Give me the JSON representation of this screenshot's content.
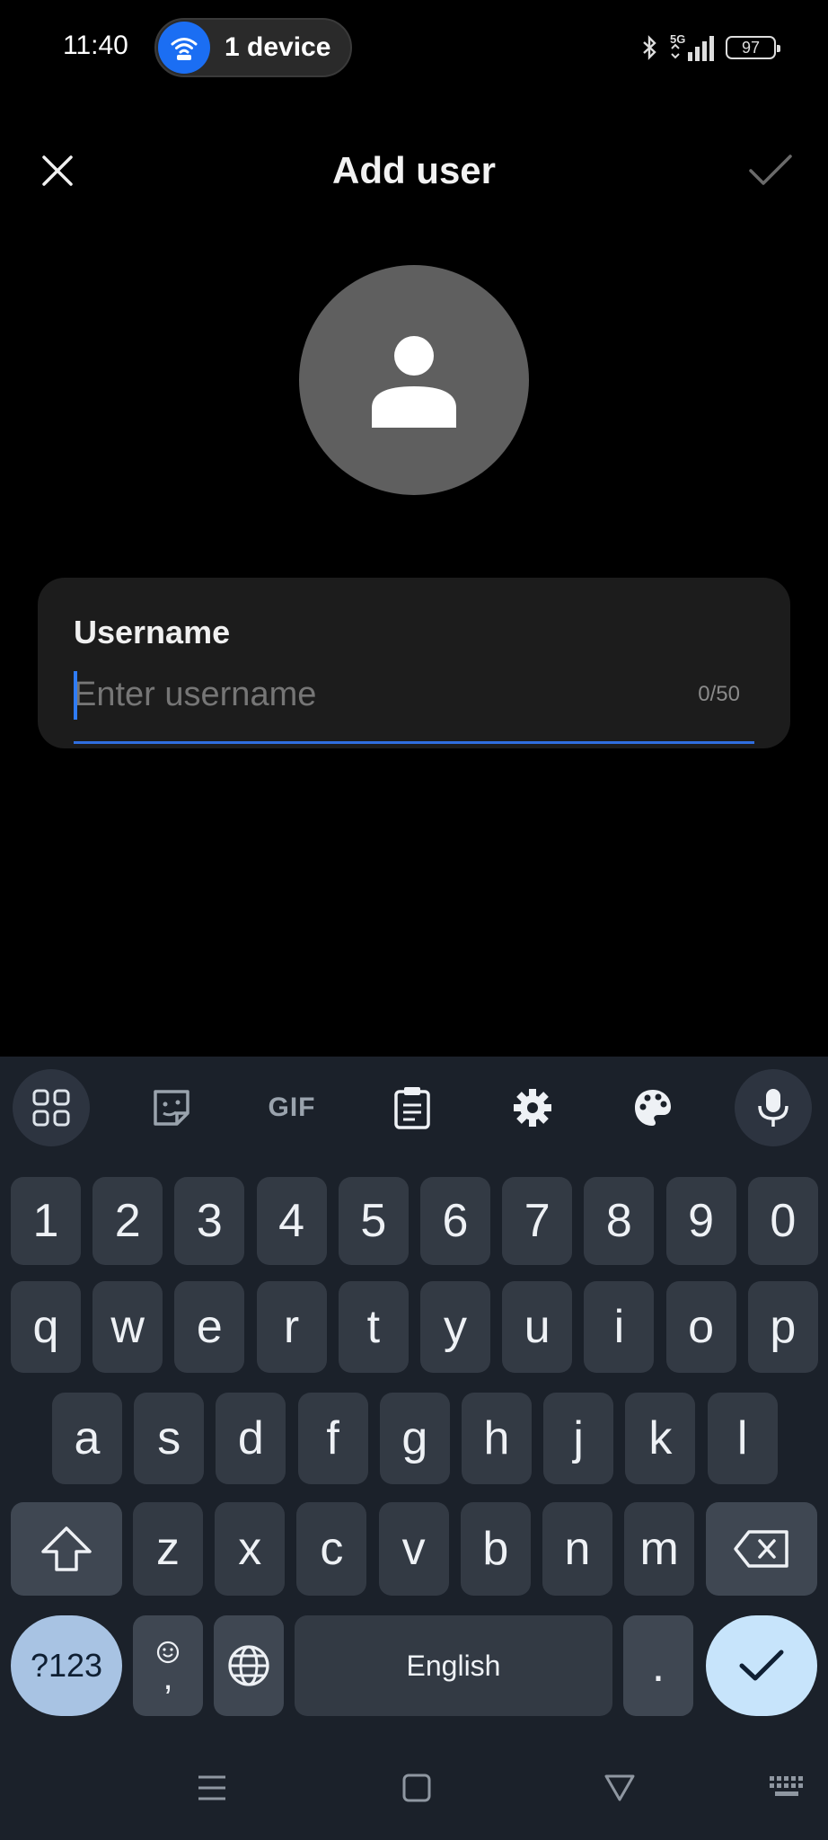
{
  "status_bar": {
    "time": "11:40",
    "hotspot_label": "1 device",
    "battery": "97",
    "network": "5G"
  },
  "app_bar": {
    "title": "Add user",
    "close_icon": "close-icon",
    "confirm_icon": "check-icon"
  },
  "avatar": {
    "icon": "person-icon"
  },
  "username": {
    "label": "Username",
    "placeholder": "Enter username",
    "value": "",
    "counter": "0/50"
  },
  "keyboard": {
    "toolbar": [
      "apps-grid-icon",
      "sticker-icon",
      "GIF",
      "clipboard-icon",
      "gear-icon",
      "palette-icon",
      "mic-icon"
    ],
    "numbers": [
      "1",
      "2",
      "3",
      "4",
      "5",
      "6",
      "7",
      "8",
      "9",
      "0"
    ],
    "row1": [
      "q",
      "w",
      "e",
      "r",
      "t",
      "y",
      "u",
      "i",
      "o",
      "p"
    ],
    "row2": [
      "a",
      "s",
      "d",
      "f",
      "g",
      "h",
      "j",
      "k",
      "l"
    ],
    "row3": [
      "z",
      "x",
      "c",
      "v",
      "b",
      "n",
      "m"
    ],
    "symbols_label": "?123",
    "comma_label": ",",
    "space_label": "English",
    "period_label": "."
  },
  "colors": {
    "accent": "#2f6ee0",
    "keyboard_bg": "#1b212a",
    "key_bg": "#333a44",
    "enter_bg": "#c7e4fb"
  }
}
